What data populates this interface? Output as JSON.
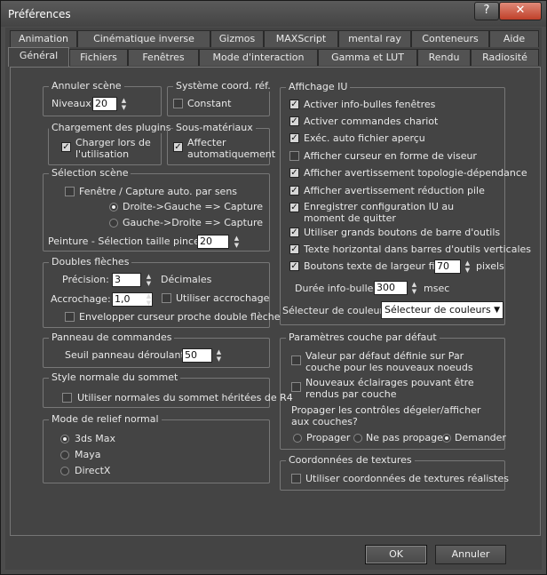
{
  "window": {
    "title": "Préférences",
    "help": "?",
    "close": "✕"
  },
  "tabs_row1": [
    "Animation",
    "Cinématique inverse",
    "Gizmos",
    "MAXScript",
    "mental ray",
    "Conteneurs",
    "Aide"
  ],
  "tabs_row2": [
    "Général",
    "Fichiers",
    "Fenêtres",
    "Mode d'interaction",
    "Gamma et LUT",
    "Rendu",
    "Radiosité"
  ],
  "annuler_scene": {
    "title": "Annuler scène",
    "niveaux_label": "Niveaux:",
    "niveaux_value": "20"
  },
  "systeme_coord": {
    "title": "Système coord. réf.",
    "constant": "Constant"
  },
  "plugins": {
    "title": "Chargement des plugins",
    "line1": "Charger lors de",
    "line2": "l'utilisation"
  },
  "sous_materiaux": {
    "title": "Sous-matériaux",
    "line1": "Affecter",
    "line2": "automatiquement"
  },
  "selection": {
    "title": "Sélection scène",
    "fenetre": "Fenêtre / Capture auto. par sens",
    "droite": "Droite->Gauche => Capture",
    "gauche": "Gauche->Droite => Capture",
    "peinture_label": "Peinture - Sélection taille pinceau",
    "peinture_value": "20"
  },
  "doubles_fleches": {
    "title": "Doubles flèches",
    "precision_label": "Précision:",
    "precision_value": "3",
    "decimales": "Décimales",
    "accrochage_label": "Accrochage:",
    "accrochage_value": "1,0",
    "utiliser_accrochage": "Utiliser accrochage",
    "envelopper": "Envelopper curseur proche double flèche"
  },
  "panneau": {
    "title": "Panneau de commandes",
    "seuil_label": "Seuil panneau déroulant:",
    "seuil_value": "50"
  },
  "style_normale": {
    "title": "Style normale du sommet",
    "utiliser": "Utiliser normales du sommet héritées de R4"
  },
  "mode_relief": {
    "title": "Mode de relief normal",
    "options": [
      "3ds Max",
      "Maya",
      "DirectX"
    ]
  },
  "affichage_iu": {
    "title": "Affichage IU",
    "items": [
      "Activer info-bulles fenêtres",
      "Activer commandes chariot",
      "Exéc. auto fichier aperçu",
      "Afficher curseur en forme de viseur",
      "Afficher avertissement topologie-dépendance",
      "Afficher avertissement réduction pile"
    ],
    "enregistrer_line1": "Enregistrer configuration IU au",
    "enregistrer_line2": "moment de quitter",
    "grands_boutons": "Utiliser grands boutons de barre d'outils",
    "texte_horizontal": "Texte horizontal dans barres d'outils verticales",
    "boutons_texte": "Boutons texte de largeur fixe:",
    "boutons_texte_value": "70",
    "pixels": "pixels",
    "duree_label": "Durée info-bulles:",
    "duree_value": "300",
    "msec": "msec",
    "selecteur_label": "Sélecteur de couleurs:",
    "selecteur_value": "Sélecteur de couleurs pa"
  },
  "couche": {
    "title": "Paramètres couche par défaut",
    "valeur_line1": "Valeur par défaut définie sur Par",
    "valeur_line2": "couche pour les nouveaux noeuds",
    "nouveaux_line1": "Nouveaux éclairages pouvant être",
    "nouveaux_line2": "rendus par couche",
    "propager_line1": "Propager les contrôles dégeler/afficher",
    "propager_line2": "aux couches?",
    "options": [
      "Propager",
      "Ne pas propager",
      "Demander"
    ]
  },
  "textures": {
    "title": "Coordonnées de textures",
    "utiliser": "Utiliser coordonnées de textures réalistes"
  },
  "buttons": {
    "ok": "OK",
    "annuler": "Annuler"
  }
}
